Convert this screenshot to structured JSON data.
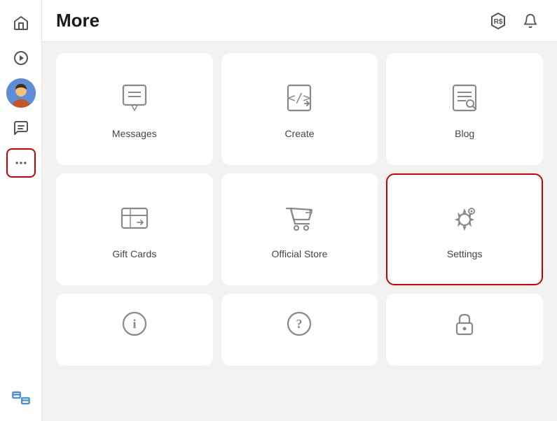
{
  "header": {
    "title": "More",
    "robux_icon": "robux-icon",
    "bell_icon": "bell-icon"
  },
  "sidebar": {
    "items": [
      {
        "id": "home",
        "icon": "home-icon",
        "label": "Home"
      },
      {
        "id": "discover",
        "icon": "discover-icon",
        "label": "Discover"
      },
      {
        "id": "avatar",
        "icon": "avatar-icon",
        "label": "Avatar"
      },
      {
        "id": "chat",
        "icon": "chat-icon",
        "label": "Chat"
      },
      {
        "id": "more",
        "icon": "more-icon",
        "label": "More",
        "active": true
      }
    ],
    "bottom_item": {
      "id": "robux",
      "icon": "robux-bottom-icon",
      "label": "Robux"
    }
  },
  "grid": {
    "items": [
      {
        "id": "messages",
        "label": "Messages",
        "icon": "messages-icon"
      },
      {
        "id": "create",
        "label": "Create",
        "icon": "create-icon"
      },
      {
        "id": "blog",
        "label": "Blog",
        "icon": "blog-icon"
      },
      {
        "id": "gift-cards",
        "label": "Gift Cards",
        "icon": "gift-cards-icon"
      },
      {
        "id": "official-store",
        "label": "Official Store",
        "icon": "official-store-icon"
      },
      {
        "id": "settings",
        "label": "Settings",
        "icon": "settings-icon",
        "highlighted": true
      },
      {
        "id": "info",
        "label": "",
        "icon": "info-icon",
        "partial": true
      },
      {
        "id": "help",
        "label": "",
        "icon": "help-icon",
        "partial": true
      },
      {
        "id": "lock",
        "label": "",
        "icon": "lock-icon",
        "partial": true
      }
    ]
  }
}
